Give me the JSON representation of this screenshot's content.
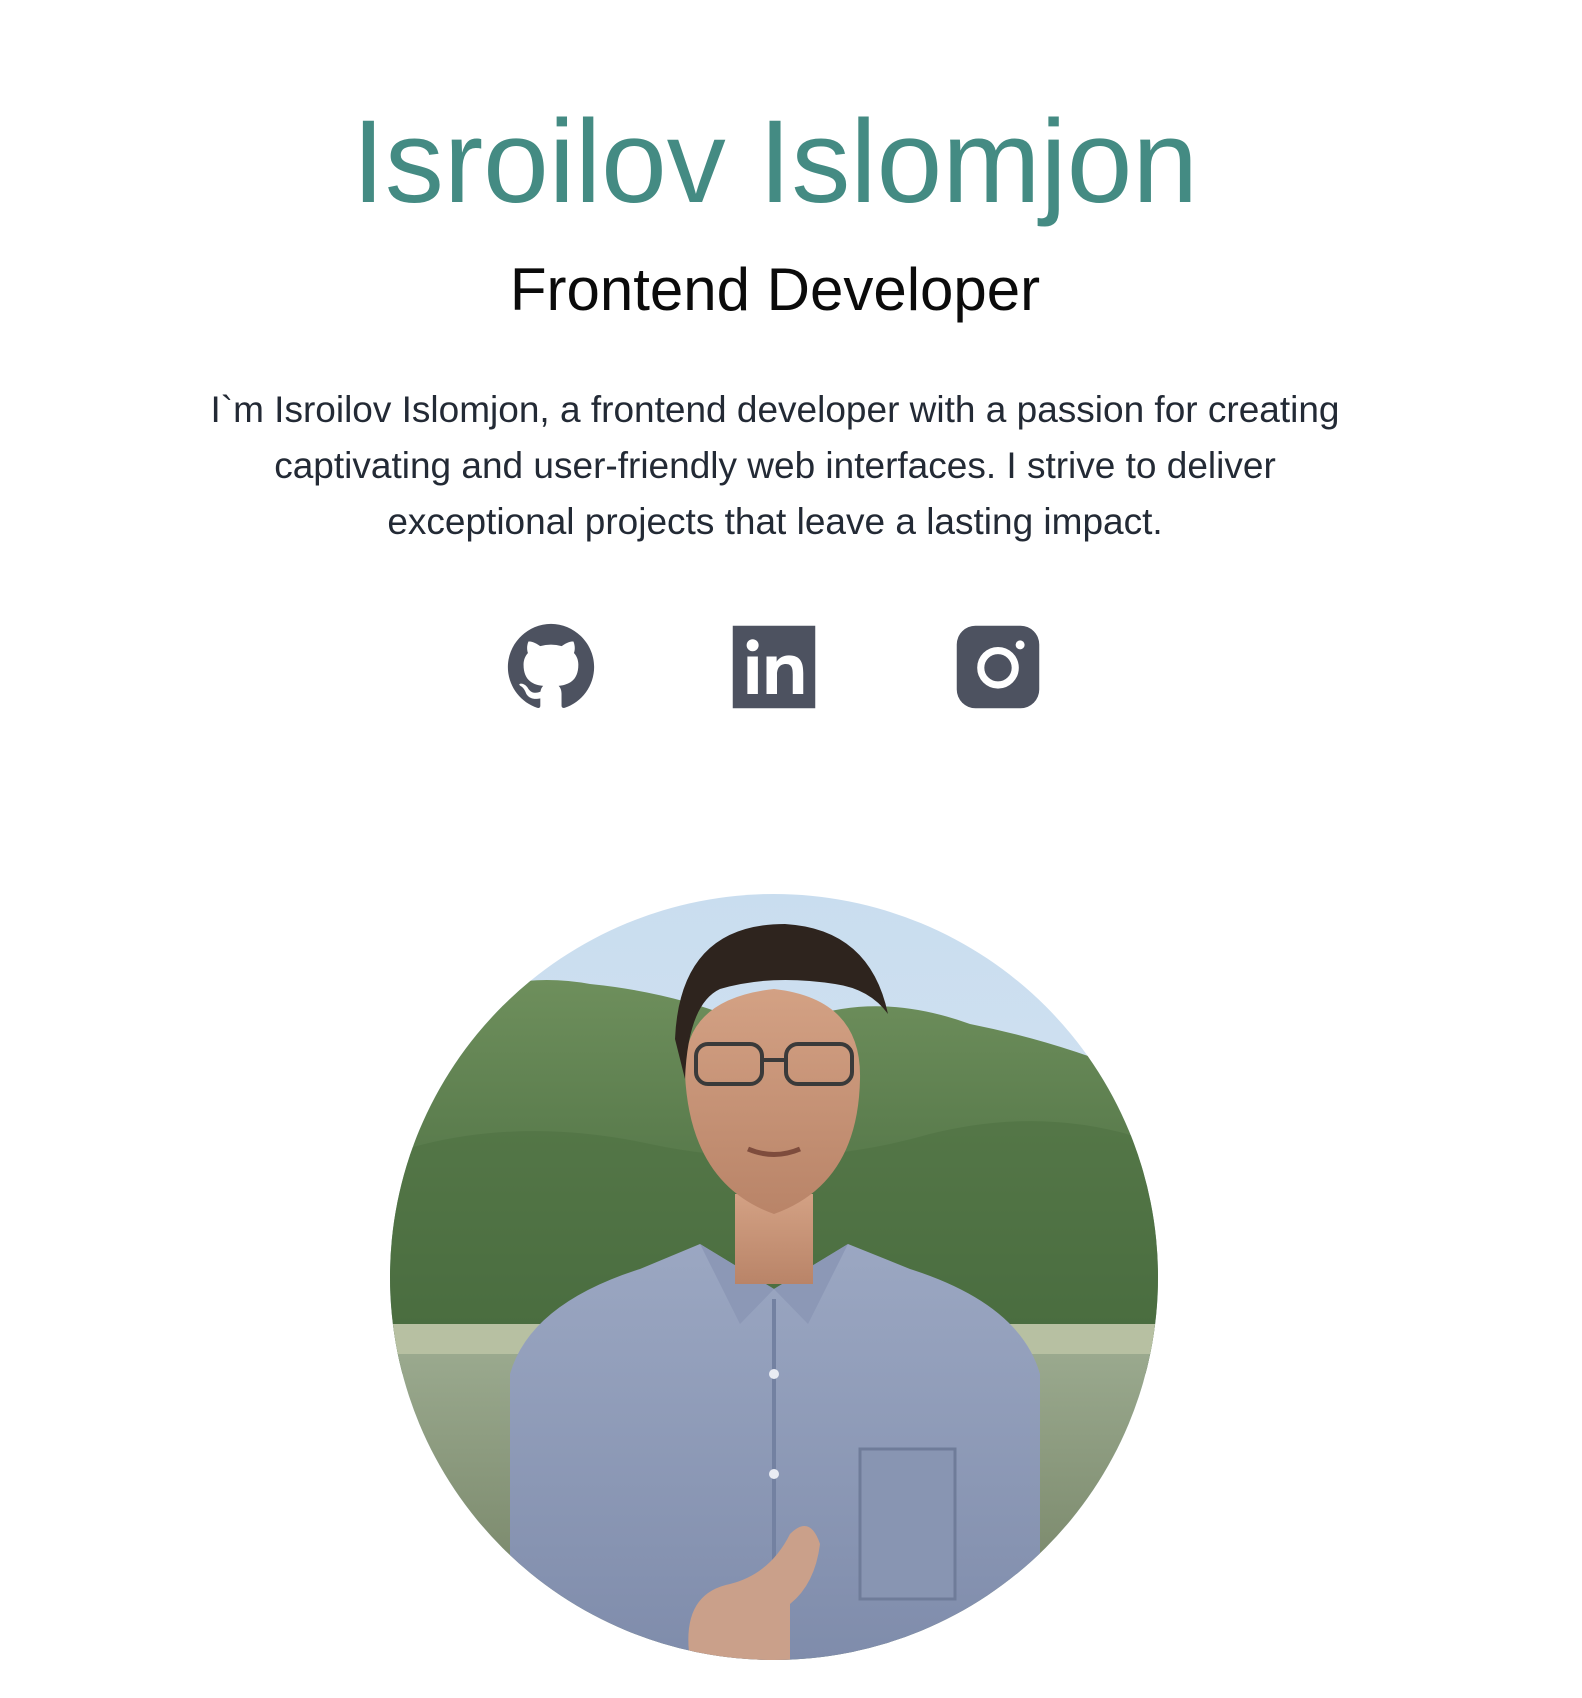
{
  "hero": {
    "name": "Isroilov Islomjon",
    "role": "Frontend Developer",
    "bio": "I`m Isroilov Islomjon, a frontend developer with a passion for creating captivating and user-friendly web interfaces. I strive to deliver exceptional projects that leave a lasting impact."
  },
  "socials": [
    {
      "icon": "github-icon"
    },
    {
      "icon": "linkedin-icon"
    },
    {
      "icon": "instagram-icon"
    }
  ],
  "colors": {
    "accent": "#448b83",
    "icon": "#4d5260",
    "heading": "#0b0b0b",
    "body_text": "#232a35"
  }
}
